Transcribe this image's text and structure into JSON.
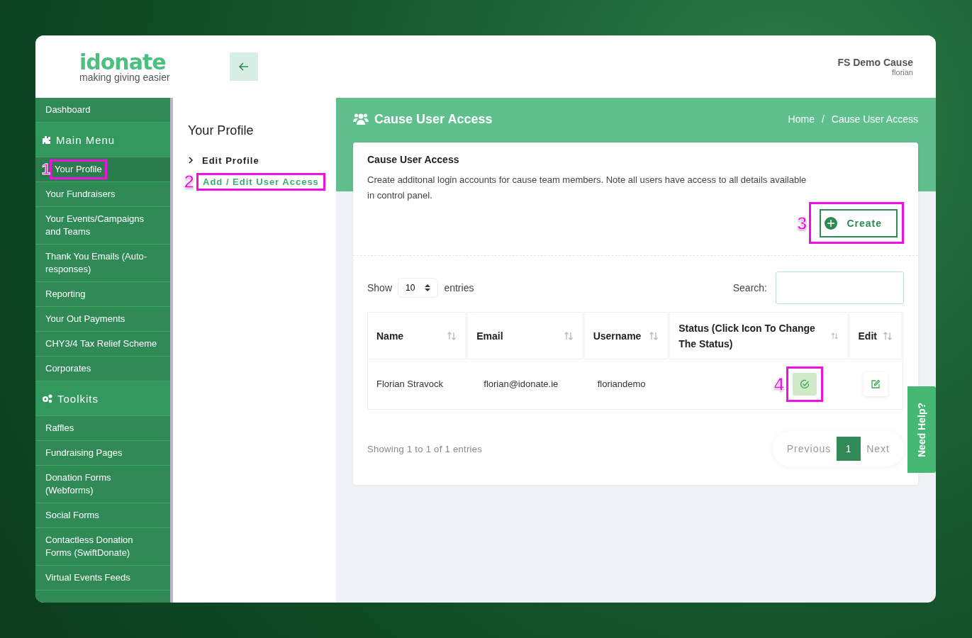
{
  "header": {
    "logo": {
      "name": "idonate",
      "tagline": "making giving easier"
    },
    "account": {
      "name": "FS Demo Cause",
      "user": "florian"
    }
  },
  "sidebar": {
    "items": [
      {
        "kind": "link",
        "label": "Dashboard",
        "selected": false
      },
      {
        "kind": "section",
        "label": "Main Menu"
      },
      {
        "kind": "link",
        "label": "Your Profile",
        "selected": true,
        "step": "1"
      },
      {
        "kind": "link",
        "label": "Your Fundraisers",
        "selected": false
      },
      {
        "kind": "link",
        "label": "Your Events/Campaigns and Teams",
        "selected": false
      },
      {
        "kind": "link",
        "label": "Thank You Emails (Auto-responses)",
        "selected": false
      },
      {
        "kind": "link",
        "label": "Reporting",
        "selected": false
      },
      {
        "kind": "link",
        "label": "Your Out Payments",
        "selected": false
      },
      {
        "kind": "link",
        "label": "CHY3/4 Tax Relief Scheme",
        "selected": false
      },
      {
        "kind": "link",
        "label": "Corporates",
        "selected": false
      },
      {
        "kind": "section",
        "label": "Toolkits"
      },
      {
        "kind": "link",
        "label": "Raffles",
        "selected": false
      },
      {
        "kind": "link",
        "label": "Fundraising Pages",
        "selected": false
      },
      {
        "kind": "link",
        "label": "Donation Forms (Webforms)",
        "selected": false
      },
      {
        "kind": "link",
        "label": "Social Forms",
        "selected": false
      },
      {
        "kind": "link",
        "label": "Contactless Donation Forms (SwiftDonate)",
        "selected": false
      },
      {
        "kind": "link",
        "label": "Virtual Events Feeds",
        "selected": false
      }
    ]
  },
  "submenu": {
    "title": "Your Profile",
    "items": [
      {
        "label": "Edit Profile",
        "selected": false
      },
      {
        "label": "Add / Edit User Access",
        "selected": true,
        "step": "2"
      }
    ]
  },
  "page": {
    "title": "Cause User Access",
    "breadcrumb": [
      "Home",
      "Cause User Access"
    ],
    "breadcrumb_separator": "/"
  },
  "card": {
    "title": "Cause User Access",
    "description": "Create additonal login accounts for cause team members. Note all users have access to all details available in control panel.",
    "create_button": {
      "label": "Create",
      "step": "3"
    }
  },
  "table": {
    "show_label": "Show",
    "page_size": "10",
    "entries_label": "entries",
    "search_label": "Search:",
    "columns": [
      "Name",
      "Email",
      "Username",
      "Status (Click Icon To Change The Status)",
      "Edit"
    ],
    "rows": [
      {
        "name": "Florian Stravock",
        "email": "florian@idonate.ie",
        "username": "floriandemo",
        "active": true,
        "step": "4"
      }
    ],
    "info": "Showing 1 to 1 of 1 entries",
    "pagination": [
      {
        "label": "Previous",
        "selected": false
      },
      {
        "label": "1",
        "selected": true
      },
      {
        "label": "Next",
        "selected": false
      }
    ]
  },
  "help_tab": "Need Help?"
}
